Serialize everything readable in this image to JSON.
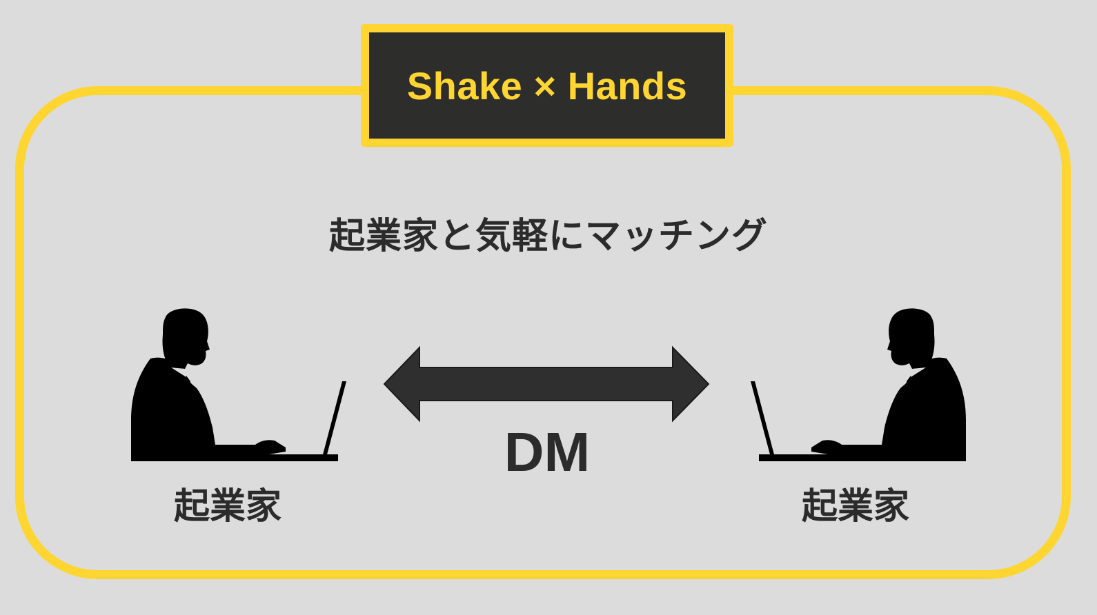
{
  "title": "Shake × Hands",
  "subtitle": "起業家と気軽にマッチング",
  "left_person": {
    "label": "起業家",
    "icon": "entrepreneur-at-laptop-icon"
  },
  "right_person": {
    "label": "起業家",
    "icon": "entrepreneur-at-laptop-icon"
  },
  "connection": {
    "label": "DM",
    "icon": "double-headed-arrow-icon"
  },
  "colors": {
    "background": "#dcdcdc",
    "accent_yellow": "#fed531",
    "title_box_bg": "#2d2d2b",
    "text_dark": "#2b2b2b",
    "silhouette": "#000000"
  }
}
